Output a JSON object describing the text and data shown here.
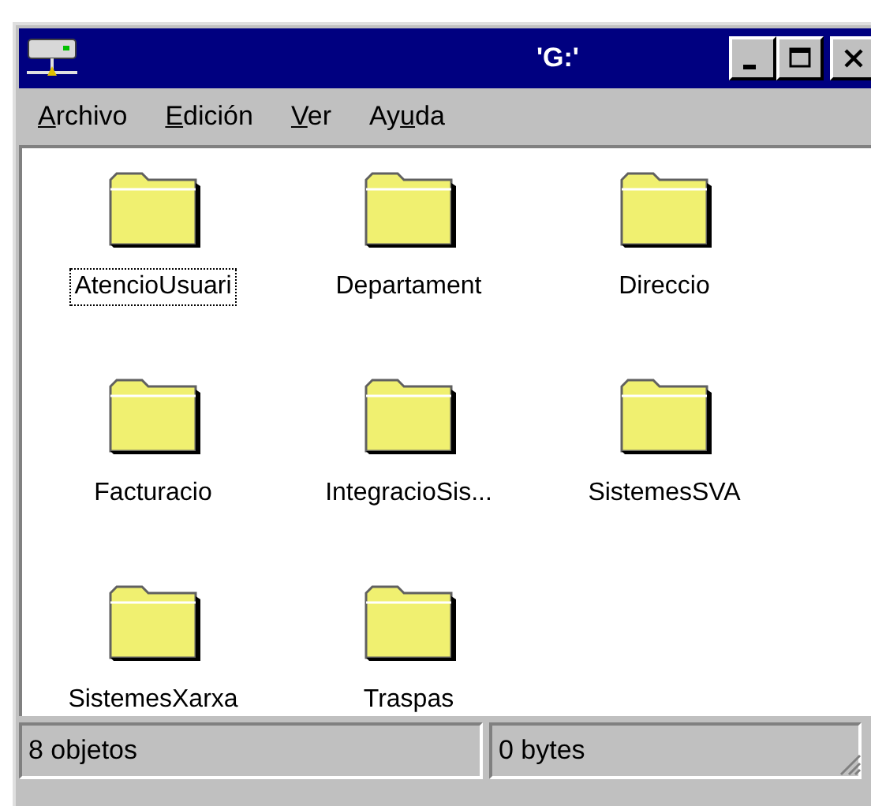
{
  "window": {
    "title": "'G:'"
  },
  "menu": [
    {
      "access_key": "A",
      "rest": "rchivo"
    },
    {
      "access_key": "E",
      "rest": "dición"
    },
    {
      "access_key": "V",
      "rest": "er"
    },
    {
      "lead": "Ay",
      "access_key": "u",
      "rest": "da"
    }
  ],
  "items": [
    {
      "name": "AtencioUsuari",
      "selected": true
    },
    {
      "name": "Departament",
      "selected": false
    },
    {
      "name": "Direccio",
      "selected": false
    },
    {
      "name": "Facturacio",
      "selected": false
    },
    {
      "name": "IntegracioSis...",
      "selected": false
    },
    {
      "name": "SistemesSVA",
      "selected": false
    },
    {
      "name": "SistemesXarxa",
      "selected": false
    },
    {
      "name": "Traspas",
      "selected": false
    }
  ],
  "status_bar": [
    "8 objetos",
    "0 bytes"
  ]
}
